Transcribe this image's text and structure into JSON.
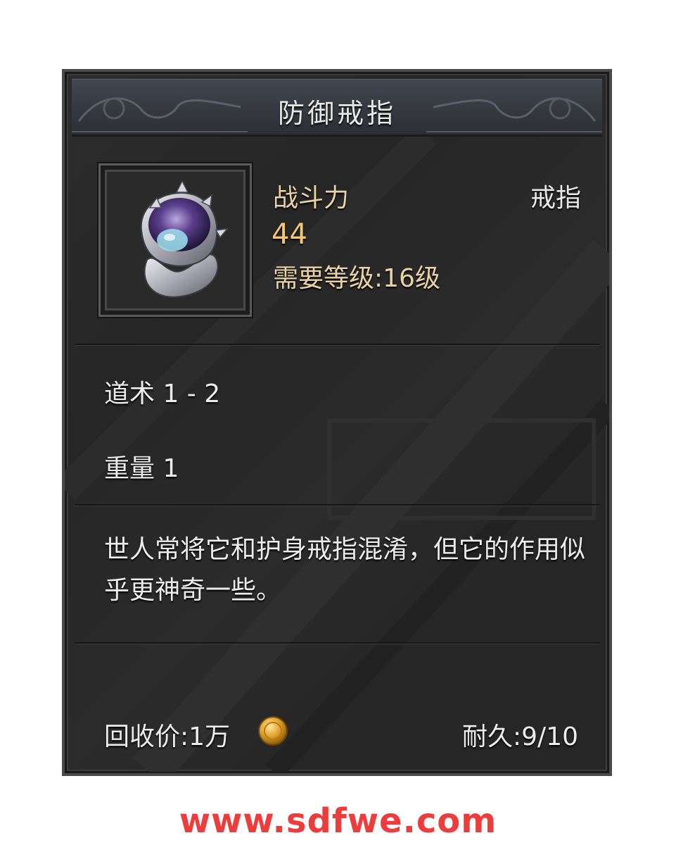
{
  "item": {
    "name": "防御戒指",
    "combat_power_label": "战斗力",
    "combat_power_value": "44",
    "type": "戒指",
    "required_level": "需要等级:16级",
    "icon": "ring-icon"
  },
  "stats": [
    {
      "text": "道术 1 - 2"
    },
    {
      "text": "重量 1"
    }
  ],
  "description": "世人常将它和护身戒指混淆，但它的作用似乎更神奇一些。",
  "footer": {
    "recycle_price": "回收价:1万",
    "currency_icon": "gold-coin-icon",
    "durability": "耐久:9/10"
  },
  "watermark": "www.sdfwe.com",
  "colors": {
    "panel_bg": "#262626",
    "title_text": "#e8e8e8",
    "gold_text": "#f2c874",
    "label_text": "#e9d3a6",
    "watermark": "#ee3b3b"
  }
}
